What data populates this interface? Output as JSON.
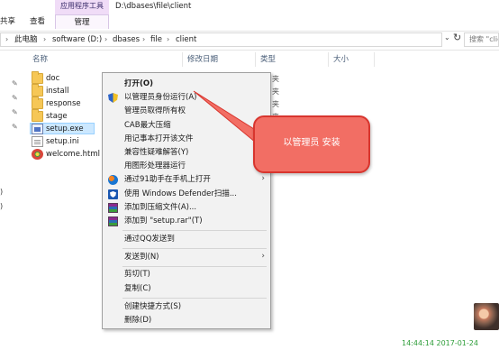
{
  "window": {
    "tools_group": "应用程序工具",
    "path_title": "D:\\dbases\\file\\client"
  },
  "ribbon": {
    "tabs": [
      "共享",
      "查看",
      "管理"
    ]
  },
  "address_bar": {
    "crumbs": [
      "此电脑",
      "software (D:)",
      "dbases",
      "file",
      "client"
    ],
    "search_placeholder": "搜索 \"client\""
  },
  "columns": [
    "名称",
    "修改日期",
    "类型",
    "大小"
  ],
  "files": [
    {
      "name": "doc",
      "icon": "folder-icon"
    },
    {
      "name": "install",
      "icon": "folder-icon"
    },
    {
      "name": "response",
      "icon": "folder-icon"
    },
    {
      "name": "stage",
      "icon": "folder-icon"
    },
    {
      "name": "setup.exe",
      "icon": "exe-icon",
      "selected": true
    },
    {
      "name": "setup.ini",
      "icon": "ini-file-icon"
    },
    {
      "name": "welcome.html",
      "icon": "html-file-icon"
    }
  ],
  "type_fragments": [
    "夹",
    "夹",
    "夹",
    "夹"
  ],
  "nav_fragments": [
    ")",
    ")"
  ],
  "context_menu": {
    "items": [
      {
        "label": "打开(O)",
        "bold": true
      },
      {
        "label": "以管理员身份运行(A)",
        "icon": "uac-shield-icon"
      },
      {
        "label": "管理员取得所有权"
      },
      {
        "label": "CAB最大压缩"
      },
      {
        "label": "用记事本打开该文件"
      },
      {
        "label": "兼容性疑难解答(Y)"
      },
      {
        "label": "用图形处理器运行",
        "submenu": true
      },
      {
        "label": "通过91助手在手机上打开",
        "icon": "91-assistant-icon",
        "submenu": true
      },
      {
        "label": "使用 Windows Defender扫描...",
        "icon": "windows-defender-icon"
      },
      {
        "label": "添加到压缩文件(A)...",
        "icon": "winrar-icon"
      },
      {
        "label": "添加到 \"setup.rar\"(T)",
        "icon": "winrar-icon"
      },
      {
        "label": "通过QQ发送到"
      },
      {
        "label": "发送到(N)",
        "submenu": true
      },
      {
        "label": "剪切(T)"
      },
      {
        "label": "复制(C)"
      },
      {
        "label": "创建快捷方式(S)"
      },
      {
        "label": "删除(D)"
      }
    ]
  },
  "annotation": {
    "text": "以管理员 安装",
    "color": "#f26e64",
    "border_color": "#d8352e"
  },
  "taskbar": {
    "timestamp": "14:44:14 2017-01-24"
  },
  "colors": {
    "selection": "#cce8ff",
    "tools_accent": "#f0dcf7",
    "timestamp": "#2f9e3a"
  }
}
